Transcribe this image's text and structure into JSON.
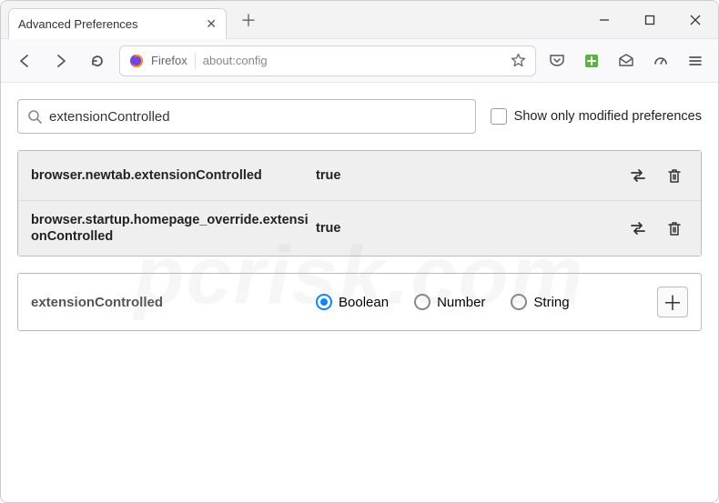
{
  "window": {
    "tab_title": "Advanced Preferences"
  },
  "toolbar": {
    "identity": "Firefox",
    "url": "about:config"
  },
  "search": {
    "value": "extensionControlled",
    "filter_label": "Show only modified preferences"
  },
  "prefs": [
    {
      "name": "browser.newtab.extensionControlled",
      "value": "true"
    },
    {
      "name": "browser.startup.homepage_override.extensionControlled",
      "value": "true"
    }
  ],
  "new_pref": {
    "name": "extensionControlled"
  },
  "types": {
    "boolean": "Boolean",
    "number": "Number",
    "string": "String",
    "selected": "Boolean"
  },
  "watermark": "pcrisk.com"
}
